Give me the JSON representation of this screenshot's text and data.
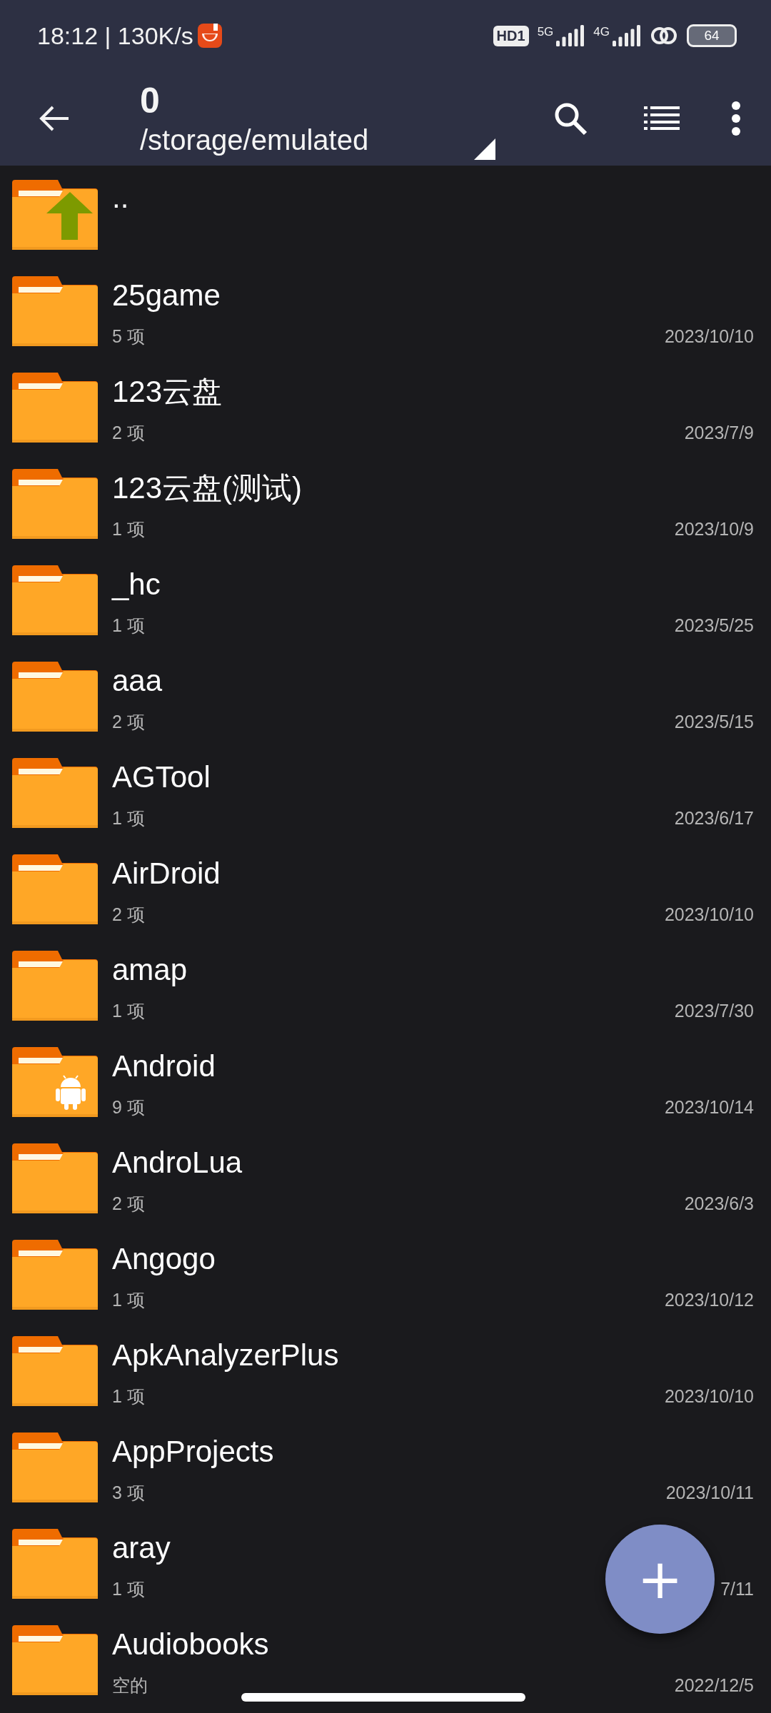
{
  "status_bar": {
    "time": "18:12 | 130K/s",
    "hd_badge": "HD1",
    "sim1_network": "5G",
    "sim2_network": "4G",
    "battery": "64"
  },
  "toolbar": {
    "title": "0",
    "path": "/storage/emulated"
  },
  "files": [
    {
      "kind": "parent",
      "name": ".."
    },
    {
      "kind": "folder",
      "name": "25game",
      "count": "5 项",
      "date": "2023/10/10"
    },
    {
      "kind": "folder",
      "name": "123云盘",
      "count": "2 项",
      "date": "2023/7/9"
    },
    {
      "kind": "folder",
      "name": "123云盘(测试)",
      "count": "1 项",
      "date": "2023/10/9"
    },
    {
      "kind": "folder",
      "name": "_hc",
      "count": "1 项",
      "date": "2023/5/25"
    },
    {
      "kind": "folder",
      "name": "aaa",
      "count": "2 项",
      "date": "2023/5/15"
    },
    {
      "kind": "folder",
      "name": "AGTool",
      "count": "1 项",
      "date": "2023/6/17"
    },
    {
      "kind": "folder",
      "name": "AirDroid",
      "count": "2 项",
      "date": "2023/10/10"
    },
    {
      "kind": "folder",
      "name": "amap",
      "count": "1 项",
      "date": "2023/7/30"
    },
    {
      "kind": "android",
      "name": "Android",
      "count": "9 项",
      "date": "2023/10/14"
    },
    {
      "kind": "folder",
      "name": "AndroLua",
      "count": "2 项",
      "date": "2023/6/3"
    },
    {
      "kind": "folder",
      "name": "Angogo",
      "count": "1 项",
      "date": "2023/10/12"
    },
    {
      "kind": "folder",
      "name": "ApkAnalyzerPlus",
      "count": "1 项",
      "date": "2023/10/10"
    },
    {
      "kind": "folder",
      "name": "AppProjects",
      "count": "3 项",
      "date": "2023/10/11"
    },
    {
      "kind": "folder",
      "name": "aray",
      "count": "1 项",
      "date": "7/11"
    },
    {
      "kind": "folder",
      "name": "Audiobooks",
      "count": "空的",
      "date": "2022/12/5"
    }
  ],
  "fab": {
    "label": "+"
  }
}
